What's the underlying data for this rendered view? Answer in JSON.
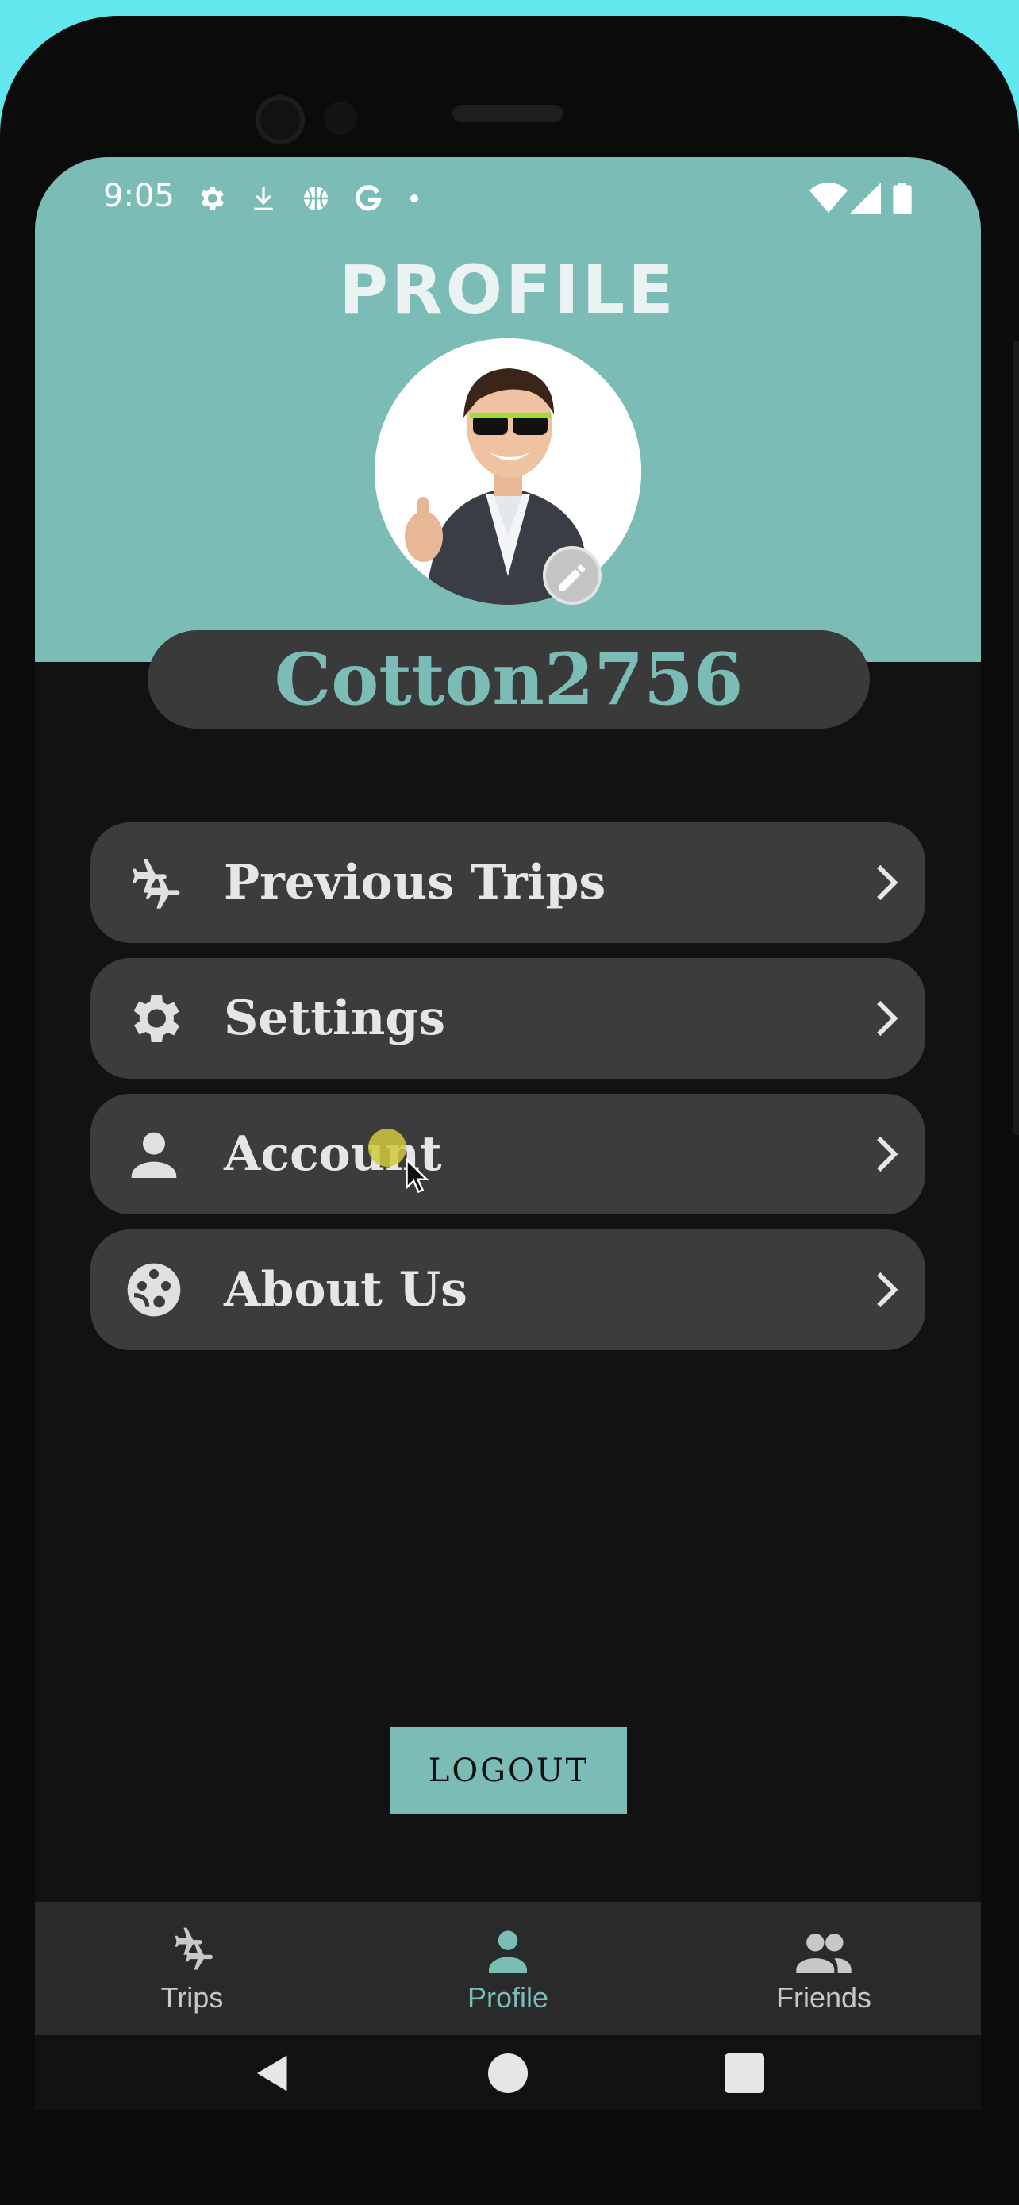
{
  "status_bar": {
    "time": "9:05",
    "left_icons": [
      "gear-icon",
      "download-icon",
      "basketball-icon",
      "google-g-icon",
      "dot-icon"
    ],
    "right_icons": [
      "wifi-icon",
      "signal-icon",
      "battery-icon"
    ]
  },
  "header": {
    "title": "PROFILE",
    "avatar_icon": "profile-photo",
    "edit_icon": "pencil-icon"
  },
  "profile": {
    "username": "Cotton2756"
  },
  "menu": {
    "items": [
      {
        "label": "Previous Trips",
        "icon": "flights-icon"
      },
      {
        "label": "Settings",
        "icon": "gear-icon"
      },
      {
        "label": "Account",
        "icon": "person-icon"
      },
      {
        "label": "About Us",
        "icon": "face-icon"
      }
    ]
  },
  "actions": {
    "logout_label": "LOGOUT"
  },
  "bottom_nav": {
    "items": [
      {
        "label": "Trips",
        "icon": "flights-icon",
        "active": false
      },
      {
        "label": "Profile",
        "icon": "person-icon",
        "active": true
      },
      {
        "label": "Friends",
        "icon": "group-icon",
        "active": false
      }
    ]
  },
  "system_nav": [
    "back-icon",
    "home-icon",
    "recents-icon"
  ],
  "colors": {
    "accent": "#7bbdb6",
    "background": "#121212",
    "card": "#3c3c3c",
    "nav_background": "#2a2a2a"
  }
}
